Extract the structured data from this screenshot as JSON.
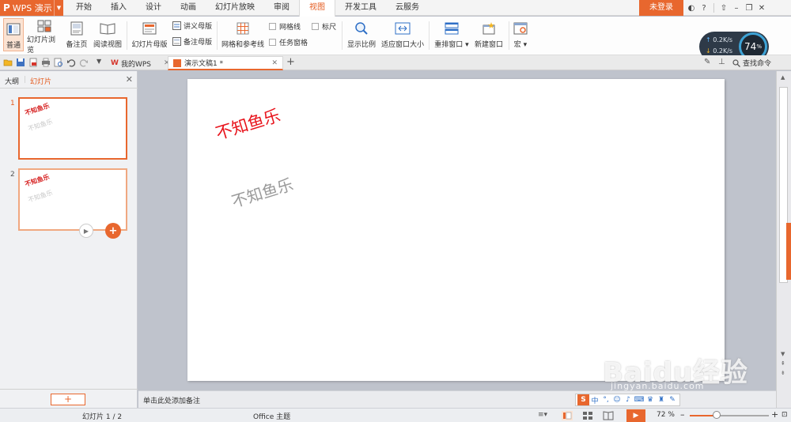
{
  "menubar": {
    "app_name": "WPS 演示",
    "tabs": [
      "开始",
      "插入",
      "设计",
      "动画",
      "幻灯片放映",
      "审阅",
      "视图",
      "开发工具",
      "云服务"
    ],
    "active_tab": "视图",
    "login": "未登录",
    "help": "?"
  },
  "ribbon": {
    "normal": "普通",
    "slide_sorter": "幻灯片浏览",
    "notes_page": "备注页",
    "reading_view": "阅读视图",
    "slide_master": "幻灯片母版",
    "handout_master": "讲义母版",
    "notes_master": "备注母版",
    "grid_guides": "网格和参考线",
    "gridlines": "网格线",
    "ruler": "标尺",
    "task_pane": "任务窗格",
    "zoom": "显示比例",
    "fit_window": "适应窗口大小",
    "arrange_all": "重排窗口",
    "new_window": "新建窗口",
    "macro": "宏"
  },
  "network": {
    "up": "0.2K/s",
    "down": "0.2K/s",
    "percent": "74",
    "unit": "%"
  },
  "doc_tabs": {
    "mywps": "我的WPS",
    "document": "演示文稿1 *",
    "find_command": "查找命令"
  },
  "left_panel": {
    "tab_outline": "大纲",
    "tab_slides": "幻灯片",
    "slides": [
      {
        "number": "1",
        "title": "不知鱼乐",
        "subtitle": "不知鱼乐"
      },
      {
        "number": "2",
        "title": "不知鱼乐",
        "subtitle": "不知鱼乐"
      }
    ]
  },
  "slide": {
    "title": "不知鱼乐",
    "subtitle": "不知鱼乐"
  },
  "notes": {
    "placeholder": "单击此处添加备注"
  },
  "ime": {
    "logo": "S",
    "mode": "中"
  },
  "status": {
    "slide_counter": "幻灯片 1 / 2",
    "theme": "Office 主题",
    "zoom": "72 %"
  },
  "watermark": {
    "brand": "Baidu经验",
    "url": "jingyan.baidu.com"
  }
}
